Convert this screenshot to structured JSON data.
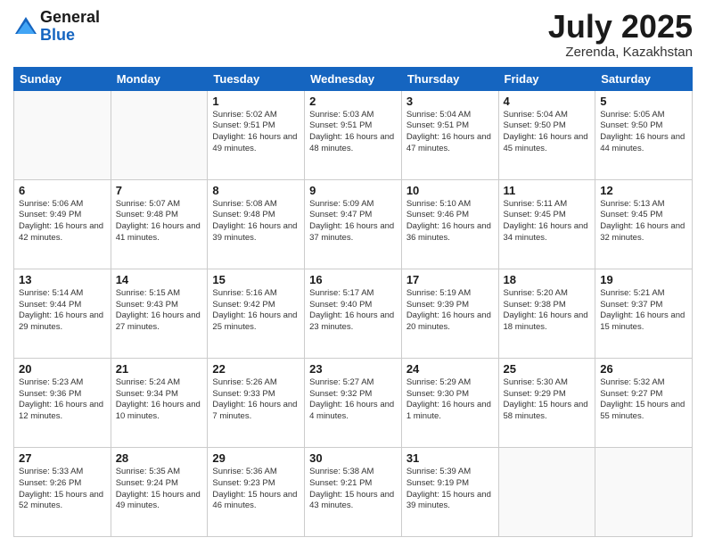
{
  "logo": {
    "general": "General",
    "blue": "Blue"
  },
  "title": "July 2025",
  "location": "Zerenda, Kazakhstan",
  "days_header": [
    "Sunday",
    "Monday",
    "Tuesday",
    "Wednesday",
    "Thursday",
    "Friday",
    "Saturday"
  ],
  "weeks": [
    [
      {
        "day": "",
        "info": ""
      },
      {
        "day": "",
        "info": ""
      },
      {
        "day": "1",
        "info": "Sunrise: 5:02 AM\nSunset: 9:51 PM\nDaylight: 16 hours and 49 minutes."
      },
      {
        "day": "2",
        "info": "Sunrise: 5:03 AM\nSunset: 9:51 PM\nDaylight: 16 hours and 48 minutes."
      },
      {
        "day": "3",
        "info": "Sunrise: 5:04 AM\nSunset: 9:51 PM\nDaylight: 16 hours and 47 minutes."
      },
      {
        "day": "4",
        "info": "Sunrise: 5:04 AM\nSunset: 9:50 PM\nDaylight: 16 hours and 45 minutes."
      },
      {
        "day": "5",
        "info": "Sunrise: 5:05 AM\nSunset: 9:50 PM\nDaylight: 16 hours and 44 minutes."
      }
    ],
    [
      {
        "day": "6",
        "info": "Sunrise: 5:06 AM\nSunset: 9:49 PM\nDaylight: 16 hours and 42 minutes."
      },
      {
        "day": "7",
        "info": "Sunrise: 5:07 AM\nSunset: 9:48 PM\nDaylight: 16 hours and 41 minutes."
      },
      {
        "day": "8",
        "info": "Sunrise: 5:08 AM\nSunset: 9:48 PM\nDaylight: 16 hours and 39 minutes."
      },
      {
        "day": "9",
        "info": "Sunrise: 5:09 AM\nSunset: 9:47 PM\nDaylight: 16 hours and 37 minutes."
      },
      {
        "day": "10",
        "info": "Sunrise: 5:10 AM\nSunset: 9:46 PM\nDaylight: 16 hours and 36 minutes."
      },
      {
        "day": "11",
        "info": "Sunrise: 5:11 AM\nSunset: 9:45 PM\nDaylight: 16 hours and 34 minutes."
      },
      {
        "day": "12",
        "info": "Sunrise: 5:13 AM\nSunset: 9:45 PM\nDaylight: 16 hours and 32 minutes."
      }
    ],
    [
      {
        "day": "13",
        "info": "Sunrise: 5:14 AM\nSunset: 9:44 PM\nDaylight: 16 hours and 29 minutes."
      },
      {
        "day": "14",
        "info": "Sunrise: 5:15 AM\nSunset: 9:43 PM\nDaylight: 16 hours and 27 minutes."
      },
      {
        "day": "15",
        "info": "Sunrise: 5:16 AM\nSunset: 9:42 PM\nDaylight: 16 hours and 25 minutes."
      },
      {
        "day": "16",
        "info": "Sunrise: 5:17 AM\nSunset: 9:40 PM\nDaylight: 16 hours and 23 minutes."
      },
      {
        "day": "17",
        "info": "Sunrise: 5:19 AM\nSunset: 9:39 PM\nDaylight: 16 hours and 20 minutes."
      },
      {
        "day": "18",
        "info": "Sunrise: 5:20 AM\nSunset: 9:38 PM\nDaylight: 16 hours and 18 minutes."
      },
      {
        "day": "19",
        "info": "Sunrise: 5:21 AM\nSunset: 9:37 PM\nDaylight: 16 hours and 15 minutes."
      }
    ],
    [
      {
        "day": "20",
        "info": "Sunrise: 5:23 AM\nSunset: 9:36 PM\nDaylight: 16 hours and 12 minutes."
      },
      {
        "day": "21",
        "info": "Sunrise: 5:24 AM\nSunset: 9:34 PM\nDaylight: 16 hours and 10 minutes."
      },
      {
        "day": "22",
        "info": "Sunrise: 5:26 AM\nSunset: 9:33 PM\nDaylight: 16 hours and 7 minutes."
      },
      {
        "day": "23",
        "info": "Sunrise: 5:27 AM\nSunset: 9:32 PM\nDaylight: 16 hours and 4 minutes."
      },
      {
        "day": "24",
        "info": "Sunrise: 5:29 AM\nSunset: 9:30 PM\nDaylight: 16 hours and 1 minute."
      },
      {
        "day": "25",
        "info": "Sunrise: 5:30 AM\nSunset: 9:29 PM\nDaylight: 15 hours and 58 minutes."
      },
      {
        "day": "26",
        "info": "Sunrise: 5:32 AM\nSunset: 9:27 PM\nDaylight: 15 hours and 55 minutes."
      }
    ],
    [
      {
        "day": "27",
        "info": "Sunrise: 5:33 AM\nSunset: 9:26 PM\nDaylight: 15 hours and 52 minutes."
      },
      {
        "day": "28",
        "info": "Sunrise: 5:35 AM\nSunset: 9:24 PM\nDaylight: 15 hours and 49 minutes."
      },
      {
        "day": "29",
        "info": "Sunrise: 5:36 AM\nSunset: 9:23 PM\nDaylight: 15 hours and 46 minutes."
      },
      {
        "day": "30",
        "info": "Sunrise: 5:38 AM\nSunset: 9:21 PM\nDaylight: 15 hours and 43 minutes."
      },
      {
        "day": "31",
        "info": "Sunrise: 5:39 AM\nSunset: 9:19 PM\nDaylight: 15 hours and 39 minutes."
      },
      {
        "day": "",
        "info": ""
      },
      {
        "day": "",
        "info": ""
      }
    ]
  ]
}
